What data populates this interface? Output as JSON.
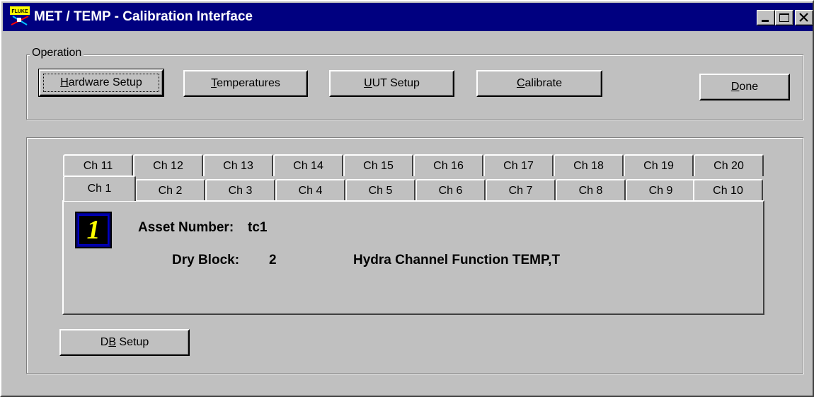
{
  "window": {
    "title": "MET / TEMP - Calibration Interface",
    "icon_text": "FLUKE",
    "title_bar_color": "#000080"
  },
  "operation": {
    "group_label": "Operation",
    "buttons": {
      "hardware_setup": {
        "pre": "",
        "key": "H",
        "post": "ardware Setup"
      },
      "temperatures": {
        "pre": "",
        "key": "T",
        "post": "emperatures"
      },
      "uut_setup": {
        "pre": "",
        "key": "U",
        "post": "UT Setup"
      },
      "calibrate": {
        "pre": "",
        "key": "C",
        "post": "alibrate"
      },
      "done": {
        "pre": "",
        "key": "D",
        "post": "one"
      }
    }
  },
  "tabs": {
    "row_top": [
      "Ch 11",
      "Ch 12",
      "Ch 13",
      "Ch 14",
      "Ch 15",
      "Ch 16",
      "Ch 17",
      "Ch 18",
      "Ch 19",
      "Ch 20"
    ],
    "row_bottom": [
      "Ch 1",
      "Ch 2",
      "Ch 3",
      "Ch 4",
      "Ch 5",
      "Ch 6",
      "Ch 7",
      "Ch 8",
      "Ch 9",
      "Ch 10"
    ],
    "active": "Ch 1"
  },
  "channel_panel": {
    "channel_number": "1",
    "asset_number_label": "Asset Number:",
    "asset_number_value": "tc1",
    "dry_block_label": "Dry Block:",
    "dry_block_value": "2",
    "hydra_function": "Hydra Channel Function TEMP,T"
  },
  "db_setup": {
    "pre": "D",
    "key": "B",
    "post": " Setup"
  },
  "colors": {
    "face": "#c0c0c0",
    "badge_digit": "#ffff00"
  }
}
